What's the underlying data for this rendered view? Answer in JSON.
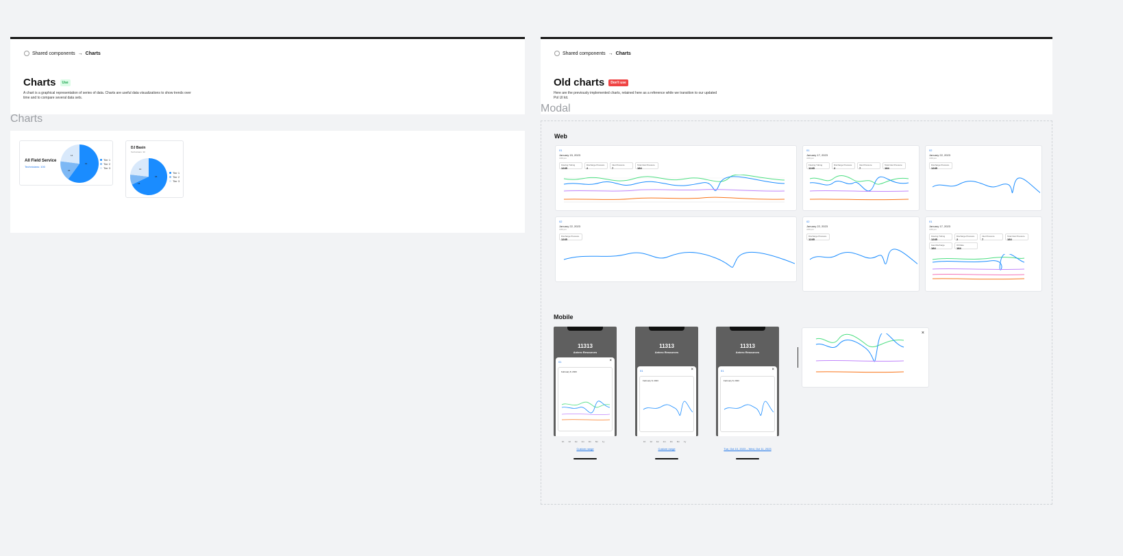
{
  "left": {
    "breadcrumb": {
      "parent": "Shared components",
      "arrow": "→",
      "current": "Charts"
    },
    "title": "Charts",
    "badge": "Use",
    "badge_color": "#16a34a",
    "description": "A chart is a graphical representation of series of data. Charts are useful data visualizations to show trends over time and to compare several data sets.",
    "section_label": "Charts",
    "pie_cards": [
      {
        "title": "All Field Service",
        "subtitle": "Technicians: 100",
        "legend": [
          "Tier 1",
          "Tier 2",
          "Tier 3"
        ],
        "slice_labels": [
          "14",
          "22",
          "64"
        ]
      },
      {
        "title": "DJ Basin",
        "subtitle": "Technicians: 30",
        "legend": [
          "Tier 1",
          "Tier 2",
          "Tier 3"
        ],
        "slice_labels": [
          "14",
          "18",
          "68"
        ]
      }
    ]
  },
  "right": {
    "breadcrumb": {
      "parent": "Shared components",
      "arrow": "→",
      "current": "Charts"
    },
    "title": "Old charts",
    "badge": "Don't use",
    "badge_color": "#ef4444",
    "description": "Here are the previously implemented charts, retained here as a reference while we transition to our updated Pol UI kit.",
    "modal_label": "Modal",
    "web_label": "Web",
    "mobile_label": "Mobile",
    "web_charts": [
      {
        "id": "01",
        "date": "January 15, 2023",
        "time": "4:00 pm",
        "chips": [
          [
            "Flowing Tubing",
            "1245"
          ],
          [
            "Discharge Pressure",
            "2"
          ],
          [
            "Inlet Pressure",
            "7"
          ],
          [
            "Total Inlet Pressure",
            "184"
          ]
        ]
      },
      {
        "id": "01",
        "date": "January 17, 2023",
        "time": "4:00 pm",
        "chips": [
          [
            "Flowing Tubing",
            "1245"
          ],
          [
            "Discharge Pressure",
            "2"
          ],
          [
            "Inlet Pressure",
            "7"
          ],
          [
            "Total Inlet Pressure",
            "184"
          ]
        ]
      },
      {
        "id": "02",
        "date": "January 22, 2023",
        "time": "4:00 pm",
        "chips": [
          [
            "Discharge Pressure",
            "1245"
          ]
        ]
      },
      {
        "id": "02",
        "date": "January 22, 2023",
        "time": "4:00 pm",
        "chips": [
          [
            "Discharge Pressure",
            "1245"
          ]
        ]
      },
      {
        "id": "02",
        "date": "January 22, 2023",
        "time": "4:00 pm",
        "chips": [
          [
            "Discharge Pressure",
            "1245"
          ]
        ]
      },
      {
        "id": "01",
        "date": "January 17, 2023",
        "time": "4:00 pm",
        "chips": [
          [
            "Flowing Tubing",
            "1245"
          ],
          [
            "Discharge Pressure",
            "2"
          ],
          [
            "Inlet Pressure",
            "7"
          ],
          [
            "Total Inlet Pressure",
            "184"
          ],
          [
            "Gas Discharge",
            "184"
          ],
          [
            "Oil Rate",
            "184"
          ]
        ]
      }
    ],
    "phones": [
      {
        "number": "11313",
        "name": "Antero Resources",
        "sheet_id": "01",
        "date": "February 8, 2023",
        "link": "Custom range"
      },
      {
        "number": "11313",
        "name": "Antero Resources",
        "sheet_id": "01",
        "date": "February 8, 2023",
        "link": "Custom range"
      },
      {
        "number": "11313",
        "name": "Antero Resources",
        "sheet_id": "01",
        "date": "February 8, 2023",
        "link": "Tue, Oct 10, 2023 – Wed, Oct 11, 2023"
      }
    ],
    "date_tabs": [
      "1h",
      "1d",
      "1w",
      "1m",
      "3m",
      "6m",
      "1y"
    ]
  },
  "colors": {
    "blue": "#1a8cff",
    "light_blue": "#7db8f5",
    "pale_blue": "#d9e9fb",
    "green": "#4ade80",
    "purple": "#c084fc",
    "orange": "#f97316",
    "pink": "#f472b6"
  }
}
